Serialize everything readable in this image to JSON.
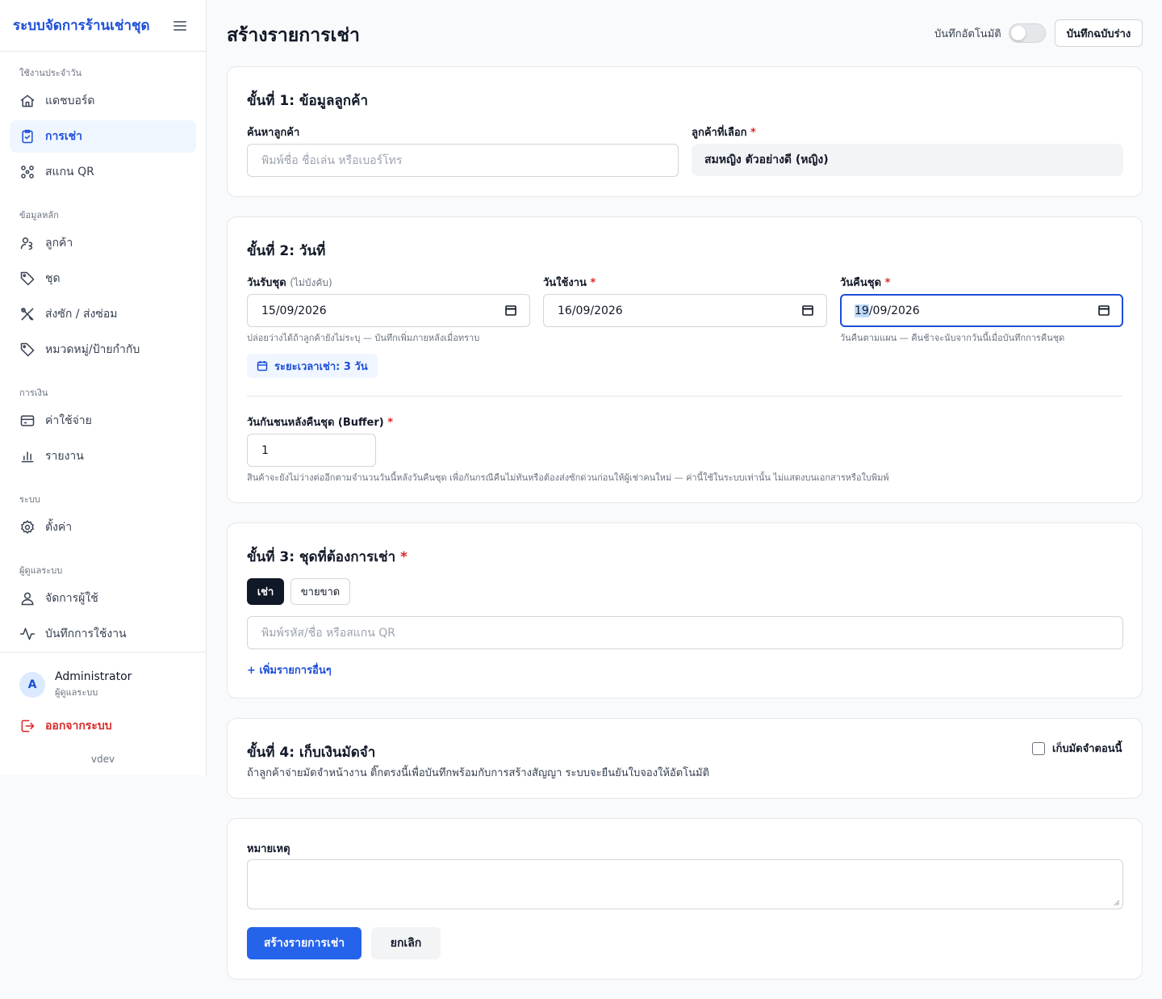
{
  "app": {
    "title": "ระบบจัดการร้านเช่าชุด",
    "version": "vdev"
  },
  "sidebar": {
    "sections": [
      {
        "label": "ใช้งานประจำวัน"
      },
      {
        "label": "ข้อมูลหลัก"
      },
      {
        "label": "การเงิน"
      },
      {
        "label": "ระบบ"
      },
      {
        "label": "ผู้ดูแลระบบ"
      }
    ],
    "items": [
      {
        "label": "แดชบอร์ด",
        "icon": "home-icon"
      },
      {
        "label": "การเช่า",
        "icon": "clipboard-check-icon",
        "active": true
      },
      {
        "label": "สแกน QR",
        "icon": "qr-icon"
      },
      {
        "label": "ลูกค้า",
        "icon": "customers-icon"
      },
      {
        "label": "ชุด",
        "icon": "tag-icon"
      },
      {
        "label": "ส่งซัก / ส่งซ่อม",
        "icon": "tools-icon"
      },
      {
        "label": "หมวดหมู่/ป้ายกำกับ",
        "icon": "label-icon"
      },
      {
        "label": "ค่าใช้จ่าย",
        "icon": "credit-card-icon"
      },
      {
        "label": "รายงาน",
        "icon": "bar-chart-icon"
      },
      {
        "label": "ตั้งค่า",
        "icon": "gear-icon"
      },
      {
        "label": "จัดการผู้ใช้",
        "icon": "user-icon"
      },
      {
        "label": "บันทึกการใช้งาน",
        "icon": "activity-icon"
      }
    ],
    "user": {
      "initial": "A",
      "name": "Administrator",
      "role": "ผู้ดูแลระบบ"
    },
    "logout_label": "ออกจากระบบ"
  },
  "header": {
    "title": "สร้างรายการเช่า",
    "autosave_label": "บันทึกอัตโนมัติ",
    "autosave_on": false,
    "draft_button": "บันทึกฉบับร่าง"
  },
  "step1": {
    "title": "ขั้นที่ 1: ข้อมูลลูกค้า",
    "search_label": "ค้นหาลูกค้า",
    "search_placeholder": "พิมพ์ชื่อ ชื่อเล่น หรือเบอร์โทร",
    "selected_label": "ลูกค้าที่เลือก",
    "selected_value": "สมหญิง ตัวอย่างดี (หญิง)"
  },
  "step2": {
    "title": "ขั้นที่ 2: วันที่",
    "pickup_label": "วันรับชุด",
    "pickup_optional": "(ไม่บังคับ)",
    "pickup_value": "15/09/2026",
    "pickup_hint": "ปล่อยว่างได้ถ้าลูกค้ายังไม่ระบุ — บันทึกเพิ่มภายหลังเมื่อทราบ",
    "use_label": "วันใช้งาน",
    "use_value": "16/09/2026",
    "return_label": "วันคืนชุด",
    "return_day": "19",
    "return_rest": "/09/2026",
    "return_hint": "วันคืนตามแผน — คืนช้าจะนับจากวันนี้เมื่อบันทึกการคืนชุด",
    "duration": "ระยะเวลาเช่า: 3 วัน",
    "buffer_label": "วันกันชนหลังคืนชุด (Buffer)",
    "buffer_value": "1",
    "buffer_hint": "สินค้าจะยังไม่ว่างต่ออีกตามจำนวนวันนี้หลังวันคืนชุด เพื่อกันกรณีคืนไม่ทันหรือต้องส่งซักด่วนก่อนให้ผู้เช่าคนใหม่ — ค่านี้ใช้ในระบบเท่านั้น ไม่แสดงบนเอกสารหรือใบพิมพ์"
  },
  "step3": {
    "title": "ขั้นที่ 3: ชุดที่ต้องการเช่า",
    "mode_rent": "เช่า",
    "mode_sell": "ขายขาด",
    "search_placeholder": "พิมพ์รหัส/ชื่อ หรือสแกน QR",
    "add_link": "+ เพิ่มรายการอื่นๆ"
  },
  "step4": {
    "title": "ขั้นที่ 4: เก็บเงินมัดจำ",
    "checkbox_label": "เก็บมัดจำตอนนี้",
    "description": "ถ้าลูกค้าจ่ายมัดจำหน้างาน ติ๊กตรงนี้เพื่อบันทึกพร้อมกับการสร้างสัญญา ระบบจะยืนยันใบจองให้อัตโนมัติ"
  },
  "notes": {
    "label": "หมายเหตุ",
    "submit": "สร้างรายการเช่า",
    "cancel": "ยกเลิก"
  },
  "colors": {
    "accent": "#1d4ed8",
    "primary_button": "#2563eb",
    "danger": "#dc2626"
  }
}
